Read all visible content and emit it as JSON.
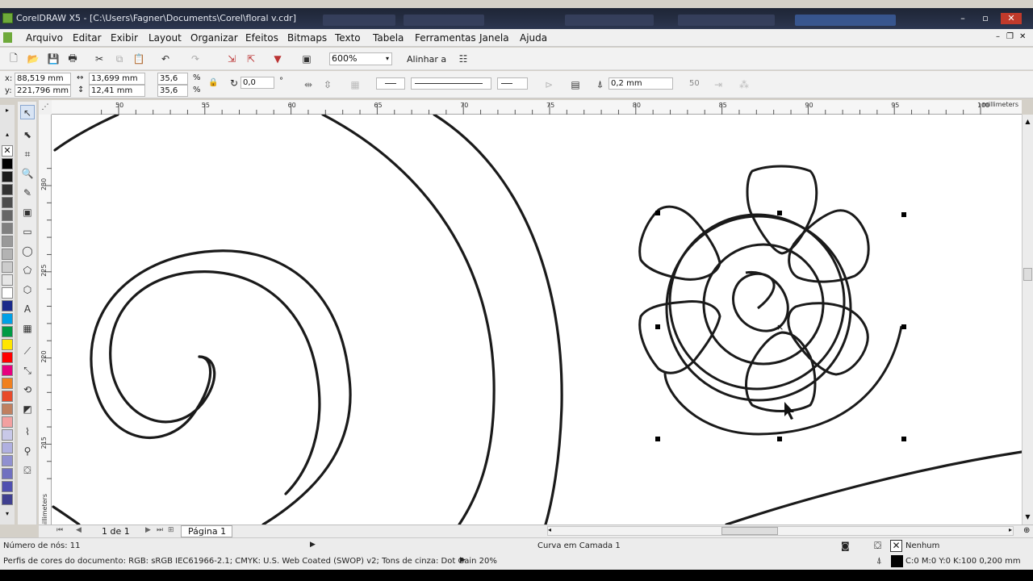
{
  "window": {
    "title": "CorelDRAW X5 - [C:\\Users\\Fagner\\Documents\\Corel\\floral v.cdr]"
  },
  "menu": [
    "Arquivo",
    "Editar",
    "Exibir",
    "Layout",
    "Organizar",
    "Efeitos",
    "Bitmaps",
    "Texto",
    "Tabela",
    "Ferramentas",
    "Janela",
    "Ajuda"
  ],
  "toolbar": {
    "zoom": "600%",
    "align_label": "Alinhar a"
  },
  "properties": {
    "x": "88,519 mm",
    "y": "221,796 mm",
    "width": "13,699 mm",
    "height": "12,41 mm",
    "scale_x": "35,6",
    "scale_y": "35,6",
    "percent": "%",
    "rotation": "0,0",
    "degree": "°",
    "outline_width": "0,2 mm",
    "smoothing": "50"
  },
  "ruler": {
    "h_ticks": [
      "50",
      "55",
      "60",
      "65",
      "70",
      "75",
      "80",
      "85",
      "90",
      "95",
      "100"
    ],
    "unit": "millimeters",
    "v_ticks": [
      "230",
      "225",
      "220",
      "215"
    ],
    "v_unit": "millimeters"
  },
  "page_nav": {
    "count": "1 de 1",
    "tab": "Página 1"
  },
  "status": {
    "nodes": "Número de nós: 11",
    "layer": "Curva em Camada 1",
    "fill": "Nenhum",
    "profile": "Perfis de cores do documento: RGB: sRGB IEC61966-2.1; CMYK: U.S. Web Coated (SWOP) v2; Tons de cinza: Dot Gain 20%",
    "outline": "C:0 M:0 Y:0 K:100  0,200 mm"
  },
  "palette_colors": [
    "#000000",
    "#1a1a1a",
    "#333333",
    "#4d4d4d",
    "#666666",
    "#808080",
    "#999999",
    "#b3b3b3",
    "#cccccc",
    "#e6e6e6",
    "#ffffff",
    "#1b2a8a",
    "#00a0e6",
    "#009a44",
    "#ffe600",
    "#ff0000",
    "#e6007e",
    "#f08020",
    "#e84a2a",
    "#c08060",
    "#f2a0a0",
    "#c8c8e8",
    "#b0b0e0",
    "#9090d0",
    "#7070c0",
    "#5050b0",
    "#404090"
  ]
}
